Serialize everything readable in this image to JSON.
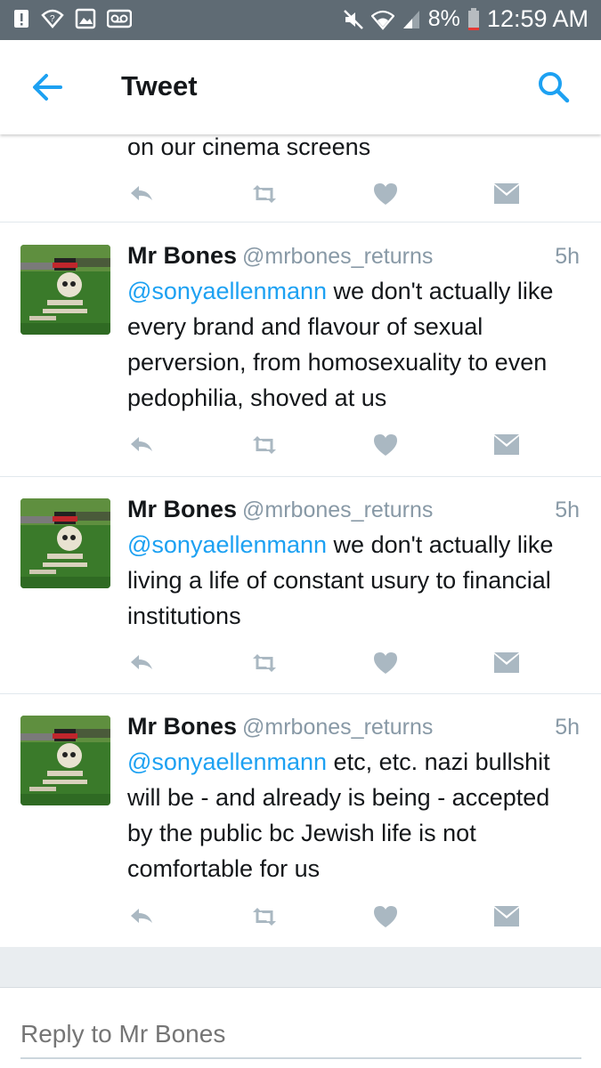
{
  "status_bar": {
    "battery_percent": "8%",
    "time": "12:59 AM",
    "left_icons": [
      "alert-icon",
      "wifi-question-icon",
      "image-icon",
      "voicemail-icon"
    ],
    "right_icons": [
      "mute-icon",
      "wifi-icon",
      "signal-icon",
      "battery-icon"
    ]
  },
  "header": {
    "title": "Tweet",
    "back_icon": "arrow-left-icon",
    "search_icon": "search-icon"
  },
  "colors": {
    "accent": "#1da1f2",
    "status_bar": "#5f6b74",
    "muted_text": "#8899a6",
    "action_icon": "#aab8c2"
  },
  "fragment": {
    "text": "on our cinema screens"
  },
  "tweets": [
    {
      "name": "Mr Bones",
      "handle": "@mrbones_returns",
      "time": "5h",
      "mention": "@sonyaellenmann",
      "text": " we don't actually like every brand and flavour of sexual perversion, from homosexuality to even pedophilia, shoved at us"
    },
    {
      "name": "Mr Bones",
      "handle": "@mrbones_returns",
      "time": "5h",
      "mention": "@sonyaellenmann",
      "text": " we don't actually like living a life of constant usury to financial institutions"
    },
    {
      "name": "Mr Bones",
      "handle": "@mrbones_returns",
      "time": "5h",
      "mention": "@sonyaellenmann",
      "text": " etc, etc. nazi bullshit will be - and already is being - accepted by the public bc Jewish life is not comfortable for us"
    }
  ],
  "reply": {
    "placeholder": "Reply to Mr Bones"
  }
}
